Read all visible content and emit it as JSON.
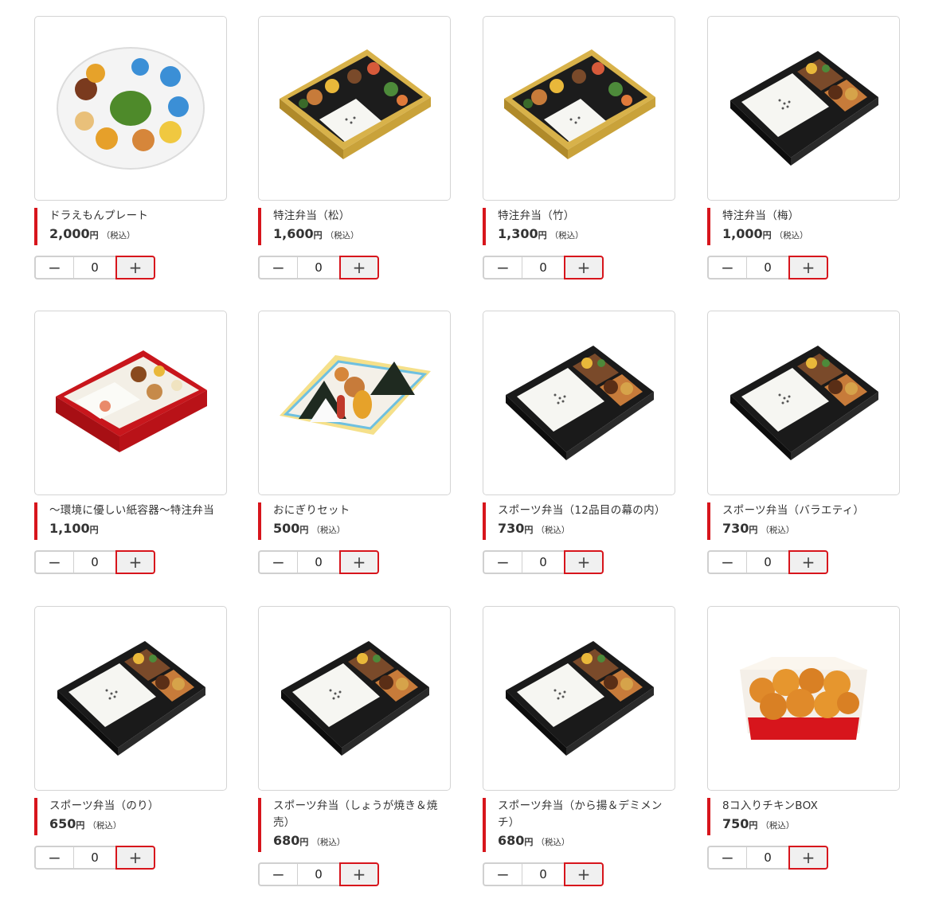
{
  "colors": {
    "accent": "#d7151c",
    "border": "#d4d4d4"
  },
  "controls": {
    "minus": "−",
    "plus": "+"
  },
  "products": [
    {
      "name": "ドラえもんプレート",
      "price": "2,000",
      "yen": "円",
      "tax": "（税込）",
      "qty": "0",
      "image": "doraemon-plate"
    },
    {
      "name": "特注弁当（松）",
      "price": "1,600",
      "yen": "円",
      "tax": "（税込）",
      "qty": "0",
      "image": "gold-bento"
    },
    {
      "name": "特注弁当（竹）",
      "price": "1,300",
      "yen": "円",
      "tax": "（税込）",
      "qty": "0",
      "image": "gold-bento"
    },
    {
      "name": "特注弁当（梅）",
      "price": "1,000",
      "yen": "円",
      "tax": "（税込）",
      "qty": "0",
      "image": "black-bento"
    },
    {
      "name": "〜環境に優しい紙容器〜特注弁当",
      "price": "1,100",
      "yen": "円",
      "tax": "",
      "qty": "0",
      "image": "red-paper-bento"
    },
    {
      "name": "おにぎりセット",
      "price": "500",
      "yen": "円",
      "tax": "（税込）",
      "qty": "0",
      "image": "onigiri-set"
    },
    {
      "name": "スポーツ弁当（12品目の幕の内）",
      "price": "730",
      "yen": "円",
      "tax": "（税込）",
      "qty": "0",
      "image": "black-bento"
    },
    {
      "name": "スポーツ弁当（バラエティ）",
      "price": "730",
      "yen": "円",
      "tax": "（税込）",
      "qty": "0",
      "image": "black-bento"
    },
    {
      "name": "スポーツ弁当（のり）",
      "price": "650",
      "yen": "円",
      "tax": "（税込）",
      "qty": "0",
      "image": "black-bento"
    },
    {
      "name": "スポーツ弁当（しょうが焼き＆焼売）",
      "price": "680",
      "yen": "円",
      "tax": "（税込）",
      "qty": "0",
      "image": "black-bento"
    },
    {
      "name": "スポーツ弁当（から揚＆デミメンチ）",
      "price": "680",
      "yen": "円",
      "tax": "（税込）",
      "qty": "0",
      "image": "black-bento"
    },
    {
      "name": "8コ入りチキンBOX",
      "price": "750",
      "yen": "円",
      "tax": "（税込）",
      "qty": "0",
      "image": "chicken-box"
    }
  ]
}
